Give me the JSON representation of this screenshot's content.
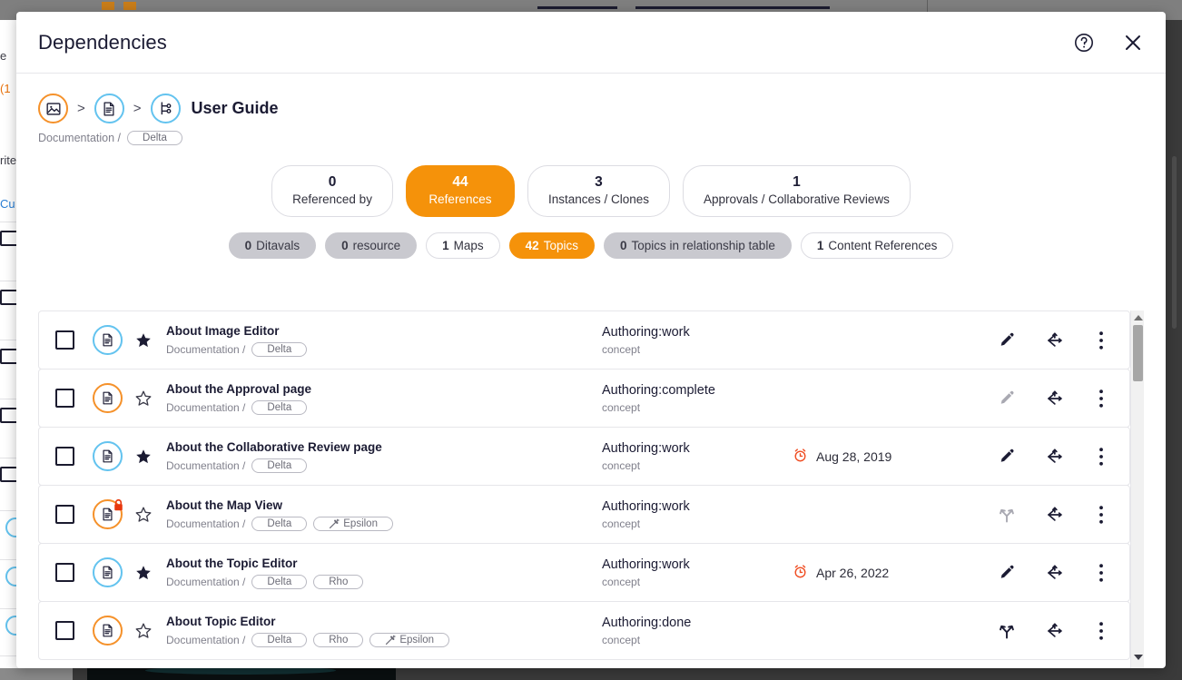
{
  "background": {
    "snippets": [
      {
        "text": "e",
        "color": "dark"
      },
      {
        "text": "(1",
        "color": "orange"
      },
      {
        "text": "rite",
        "color": "dark"
      },
      {
        "text": "Cu",
        "color": "blue"
      }
    ]
  },
  "modal": {
    "title": "Dependencies",
    "help_icon": "help-circle-icon",
    "close_icon": "close-icon"
  },
  "breadcrumb": {
    "icons": [
      "image-icon",
      "document-icon",
      "dependency-branch-icon"
    ],
    "separator": ">",
    "name": "User Guide",
    "subtitle_prefix": "Documentation /",
    "subtitle_tag": "Delta"
  },
  "summary": {
    "cards": [
      {
        "count": "0",
        "label": "Referenced by",
        "active": false
      },
      {
        "count": "44",
        "label": "References",
        "active": true
      },
      {
        "count": "3",
        "label": "Instances / Clones",
        "active": false
      },
      {
        "count": "1",
        "label": "Approvals / Collaborative Reviews",
        "active": false
      }
    ]
  },
  "chips": [
    {
      "count": "0",
      "label": "Ditavals",
      "state": "muted"
    },
    {
      "count": "0",
      "label": "resource",
      "state": "muted"
    },
    {
      "count": "1",
      "label": "Maps",
      "state": "normal"
    },
    {
      "count": "42",
      "label": "Topics",
      "state": "active"
    },
    {
      "count": "0",
      "label": "Topics in relationship table",
      "state": "muted"
    },
    {
      "count": "1",
      "label": "Content References",
      "state": "normal"
    }
  ],
  "list": {
    "rows": [
      {
        "title": "About Image Editor",
        "path_prefix": "Documentation /",
        "tags": [
          {
            "label": "Delta",
            "icon": null
          }
        ],
        "doc_color": "blue",
        "locked": false,
        "starred": true,
        "status": "Authoring:work",
        "type": "concept",
        "date": "",
        "edit_icon": "pencil-icon",
        "edit_enabled": true,
        "link_icon": "references-arrows-icon",
        "menu_icon": "kebab-menu-icon"
      },
      {
        "title": "About the Approval page",
        "path_prefix": "Documentation /",
        "tags": [
          {
            "label": "Delta",
            "icon": null
          }
        ],
        "doc_color": "orange",
        "locked": false,
        "starred": false,
        "status": "Authoring:complete",
        "type": "concept",
        "date": "",
        "edit_icon": "pencil-icon",
        "edit_enabled": false,
        "link_icon": "references-arrows-icon",
        "menu_icon": "kebab-menu-icon"
      },
      {
        "title": "About the Collaborative Review page",
        "path_prefix": "Documentation /",
        "tags": [
          {
            "label": "Delta",
            "icon": null
          }
        ],
        "doc_color": "blue",
        "locked": false,
        "starred": true,
        "status": "Authoring:work",
        "type": "concept",
        "date": "Aug 28, 2019",
        "date_icon": "alarm-clock-icon",
        "edit_icon": "pencil-icon",
        "edit_enabled": true,
        "link_icon": "references-arrows-icon",
        "menu_icon": "kebab-menu-icon"
      },
      {
        "title": "About the Map View",
        "path_prefix": "Documentation /",
        "tags": [
          {
            "label": "Delta",
            "icon": null
          },
          {
            "label": "Epsilon",
            "icon": "magic-wand-icon"
          }
        ],
        "doc_color": "orange",
        "locked": true,
        "starred": false,
        "status": "Authoring:work",
        "type": "concept",
        "date": "",
        "edit_icon": "branch-icon",
        "edit_enabled": false,
        "link_icon": "references-arrows-icon",
        "menu_icon": "kebab-menu-icon"
      },
      {
        "title": "About the Topic Editor",
        "path_prefix": "Documentation /",
        "tags": [
          {
            "label": "Delta",
            "icon": null
          },
          {
            "label": "Rho",
            "icon": null
          }
        ],
        "doc_color": "blue",
        "locked": false,
        "starred": true,
        "status": "Authoring:work",
        "type": "concept",
        "date": "Apr 26, 2022",
        "date_icon": "alarm-clock-icon",
        "edit_icon": "pencil-icon",
        "edit_enabled": true,
        "link_icon": "references-arrows-icon",
        "menu_icon": "kebab-menu-icon"
      },
      {
        "title": "About Topic Editor",
        "path_prefix": "Documentation /",
        "tags": [
          {
            "label": "Delta",
            "icon": null
          },
          {
            "label": "Rho",
            "icon": null
          },
          {
            "label": "Epsilon",
            "icon": "magic-wand-icon"
          }
        ],
        "doc_color": "orange",
        "locked": false,
        "starred": false,
        "status": "Authoring:done",
        "type": "concept",
        "date": "",
        "edit_icon": "branch-icon",
        "edit_enabled": true,
        "link_icon": "references-arrows-icon",
        "menu_icon": "kebab-menu-icon"
      }
    ]
  },
  "colors": {
    "accent_orange": "#f5920a",
    "icon_blue": "#63c3ef",
    "icon_orange": "#f5912a",
    "text_dark": "#1b1b33",
    "text_muted": "#80808c",
    "lock_red": "#e8380d"
  }
}
